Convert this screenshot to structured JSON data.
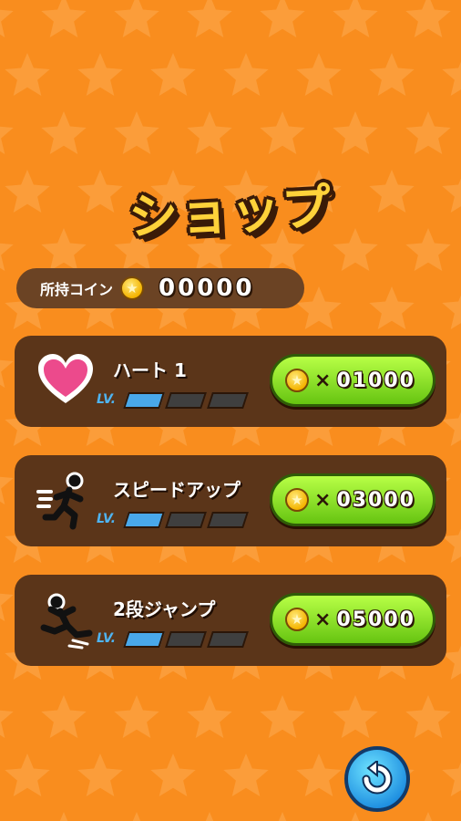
{
  "screen": {
    "title": "ショップ",
    "background_color": "#f98d1e"
  },
  "coins": {
    "label": "所持コイン",
    "amount": "00000",
    "icon": "coin-icon"
  },
  "items": [
    {
      "name": "ハート 1",
      "icon": "heart-icon",
      "level_label": "LV.",
      "level": 1,
      "max_level": 3,
      "multiplier": "×",
      "price": "01000"
    },
    {
      "name": "スピードアップ",
      "icon": "running-man-icon",
      "level_label": "LV.",
      "level": 1,
      "max_level": 3,
      "multiplier": "×",
      "price": "03000"
    },
    {
      "name": "2段ジャンプ",
      "icon": "jumping-man-icon",
      "level_label": "LV.",
      "level": 1,
      "max_level": 3,
      "multiplier": "×",
      "price": "05000"
    }
  ],
  "back_button": {
    "icon": "back-arrow-icon"
  },
  "colors": {
    "panel": "#5b3519",
    "buy_button": "#8fe02a",
    "level_active": "#49a8ea",
    "level_inactive": "#3f3f3f",
    "title": "#ffd23a"
  }
}
